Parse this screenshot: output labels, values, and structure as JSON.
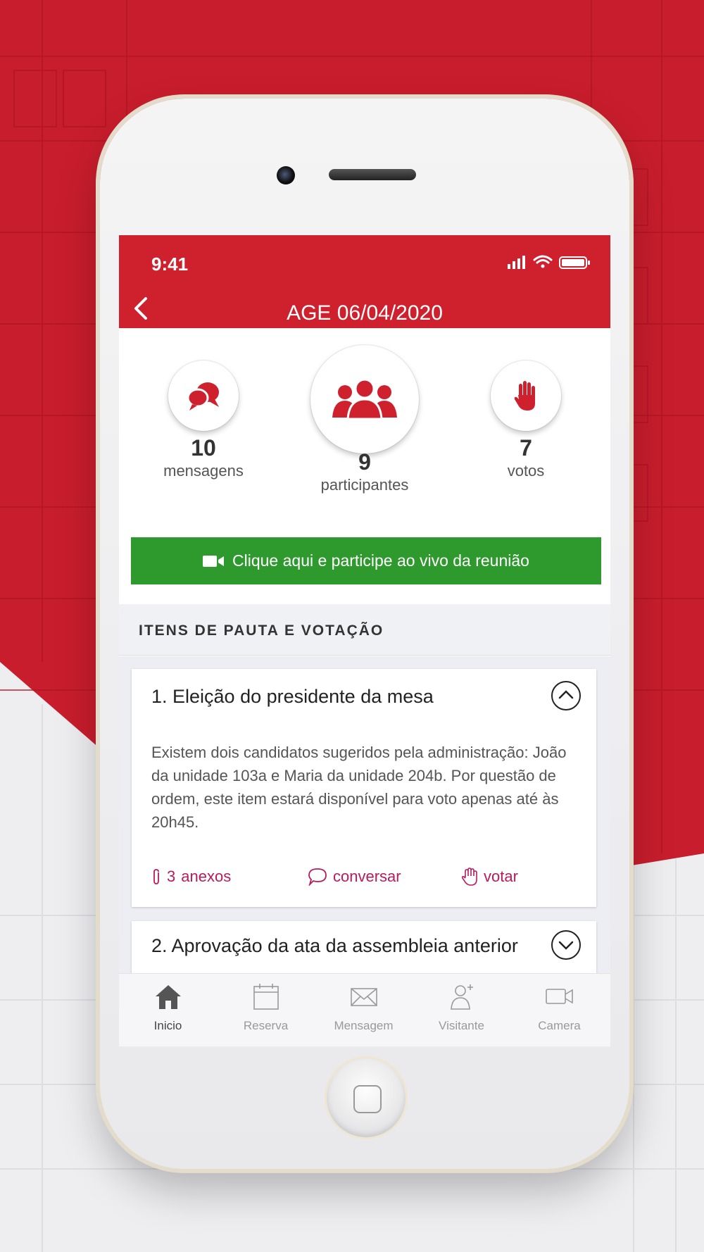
{
  "status_bar": {
    "time": "9:41"
  },
  "nav": {
    "title": "AGE 06/04/2020"
  },
  "stats": [
    {
      "value": "10",
      "label": "mensagens",
      "icon": "chat-bubbles-icon"
    },
    {
      "value": "9",
      "label": "participantes",
      "icon": "people-group-icon"
    },
    {
      "value": "7",
      "label": "votos",
      "icon": "raised-hand-icon"
    }
  ],
  "live_button": {
    "label": "Clique aqui e participe ao vivo da reunião",
    "icon": "video-camera-icon",
    "color": "#2e9a2e"
  },
  "section": {
    "title": "ITENS DE PAUTA E VOTAÇÃO"
  },
  "agenda": [
    {
      "title": "1. Eleição do presidente da mesa",
      "expanded": true,
      "description": "Existem dois candidatos sugeridos pela administração: João da unidade 103a e Maria da unidade 204b. Por questão de ordem, este item estará disponível para voto apenas até às 20h45.",
      "actions": {
        "attachments_count": "3",
        "attachments_label": "anexos",
        "chat_label": "conversar",
        "vote_label": "votar"
      }
    },
    {
      "title": "2. Aprovação da ata da assembleia anterior",
      "expanded": false
    }
  ],
  "tabbar": [
    {
      "label": "Inicio",
      "icon": "home-icon",
      "active": true
    },
    {
      "label": "Reserva",
      "icon": "calendar-icon",
      "active": false
    },
    {
      "label": "Mensagem",
      "icon": "envelope-icon",
      "active": false
    },
    {
      "label": "Visitante",
      "icon": "visitor-icon",
      "active": false
    },
    {
      "label": "Camera",
      "icon": "camera-icon",
      "active": false
    }
  ],
  "colors": {
    "brand_red": "#cf202e",
    "accent_magenta": "#b81b5e",
    "live_green": "#2e9a2e"
  }
}
